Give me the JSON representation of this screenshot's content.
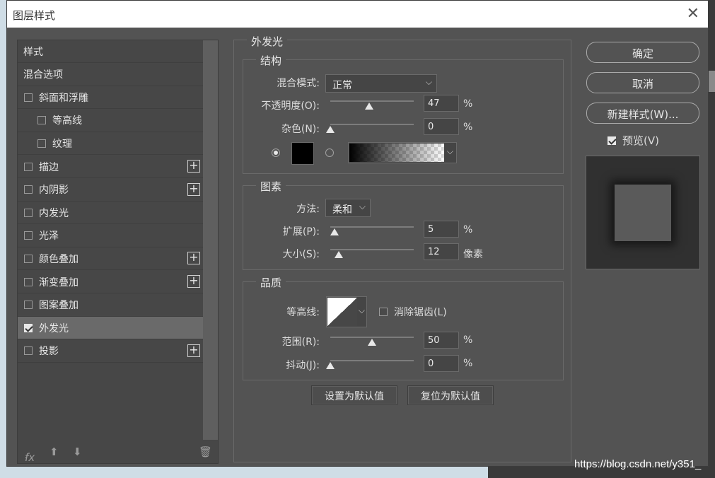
{
  "dialog": {
    "title": "图层样式"
  },
  "left": {
    "items": [
      {
        "label": "样式",
        "checkbox": false,
        "plus": false,
        "indent": 0,
        "selected": false
      },
      {
        "label": "混合选项",
        "checkbox": false,
        "plus": false,
        "indent": 0,
        "selected": false
      },
      {
        "label": "斜面和浮雕",
        "checkbox": true,
        "checked": false,
        "plus": false,
        "indent": 0
      },
      {
        "label": "等高线",
        "checkbox": true,
        "checked": false,
        "plus": false,
        "indent": 1
      },
      {
        "label": "纹理",
        "checkbox": true,
        "checked": false,
        "plus": false,
        "indent": 1
      },
      {
        "label": "描边",
        "checkbox": true,
        "checked": false,
        "plus": true,
        "indent": 0
      },
      {
        "label": "内阴影",
        "checkbox": true,
        "checked": false,
        "plus": true,
        "indent": 0
      },
      {
        "label": "内发光",
        "checkbox": true,
        "checked": false,
        "plus": false,
        "indent": 0
      },
      {
        "label": "光泽",
        "checkbox": true,
        "checked": false,
        "plus": false,
        "indent": 0
      },
      {
        "label": "颜色叠加",
        "checkbox": true,
        "checked": false,
        "plus": true,
        "indent": 0
      },
      {
        "label": "渐变叠加",
        "checkbox": true,
        "checked": false,
        "plus": true,
        "indent": 0
      },
      {
        "label": "图案叠加",
        "checkbox": true,
        "checked": false,
        "plus": false,
        "indent": 0
      },
      {
        "label": "外发光",
        "checkbox": true,
        "checked": true,
        "plus": false,
        "indent": 0,
        "selected": true
      },
      {
        "label": "投影",
        "checkbox": true,
        "checked": false,
        "plus": true,
        "indent": 0
      }
    ],
    "footer": {
      "fx_label": "fx",
      "fx_sub": "."
    }
  },
  "outer_glow": {
    "title": "外发光",
    "structure": {
      "title": "结构",
      "blend_label": "混合模式:",
      "blend_value": "正常",
      "opacity_label": "不透明度(O):",
      "opacity_value": "47",
      "opacity_fraction": 0.47,
      "noise_label": "杂色(N):",
      "noise_value": "0",
      "noise_fraction": 0,
      "percent": "%",
      "color_mode": "solid",
      "solid_color": "#000000"
    },
    "elements": {
      "title": "图素",
      "method_label": "方法:",
      "method_value": "柔和",
      "spread_label": "扩展(P):",
      "spread_value": "5",
      "spread_fraction": 0.05,
      "size_label": "大小(S):",
      "size_value": "12",
      "size_fraction": 0.1,
      "px_unit": "像素"
    },
    "quality": {
      "title": "品质",
      "contour_label": "等高线:",
      "antialias_label": "消除锯齿(L)",
      "antialias_checked": false,
      "range_label": "范围(R):",
      "range_value": "50",
      "range_fraction": 0.5,
      "jitter_label": "抖动(J):",
      "jitter_value": "0",
      "jitter_fraction": 0
    },
    "buttons": {
      "set_default": "设置为默认值",
      "reset_default": "复位为默认值"
    }
  },
  "right": {
    "ok": "确定",
    "cancel": "取消",
    "new_style": "新建样式(W)...",
    "preview_label": "预览(V)",
    "preview_checked": true
  },
  "watermark": "https://blog.csdn.net/y351_"
}
